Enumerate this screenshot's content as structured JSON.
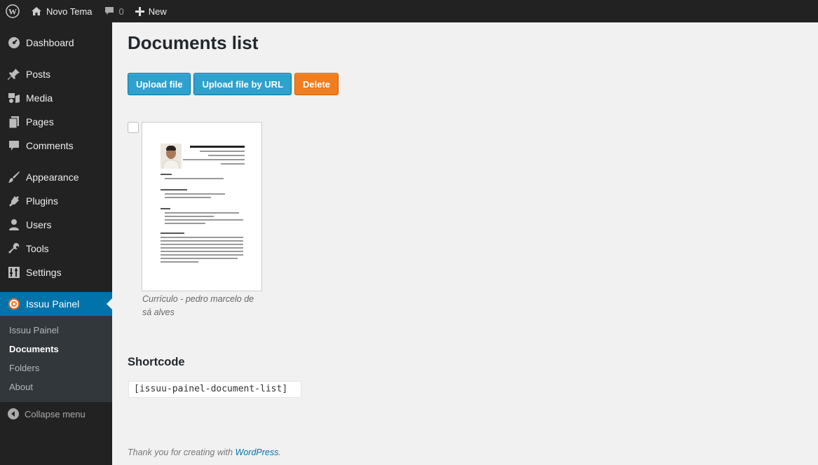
{
  "admin_bar": {
    "site_name": "Novo Tema",
    "comments_count": "0",
    "new_label": "New"
  },
  "sidebar": {
    "items": [
      {
        "label": "Dashboard",
        "icon": "dashboard-icon"
      },
      {
        "label": "Posts",
        "icon": "pin-icon"
      },
      {
        "label": "Media",
        "icon": "media-icon"
      },
      {
        "label": "Pages",
        "icon": "pages-icon"
      },
      {
        "label": "Comments",
        "icon": "comment-icon"
      },
      {
        "label": "Appearance",
        "icon": "brush-icon"
      },
      {
        "label": "Plugins",
        "icon": "plug-icon"
      },
      {
        "label": "Users",
        "icon": "user-icon"
      },
      {
        "label": "Tools",
        "icon": "wrench-icon"
      },
      {
        "label": "Settings",
        "icon": "settings-icon"
      },
      {
        "label": "Issuu Painel",
        "icon": "issuu-icon"
      }
    ],
    "submenu": [
      "Issuu Painel",
      "Documents",
      "Folders",
      "About"
    ],
    "active_submenu": "Documents",
    "collapse_label": "Collapse menu"
  },
  "main": {
    "title": "Documents list",
    "buttons": {
      "upload": "Upload file",
      "upload_url": "Upload file by URL",
      "delete": "Delete"
    },
    "document": {
      "caption": "Currículo - pedro marcelo de sá alves",
      "selected": false
    },
    "shortcode_title": "Shortcode",
    "shortcode_value": "[issuu-painel-document-list]"
  },
  "footer": {
    "text": "Thank you for creating with ",
    "link": "WordPress",
    "suffix": "."
  },
  "colors": {
    "admin_dark": "#222222",
    "active_blue": "#0073aa",
    "button_blue": "#2ea2cc",
    "delete_orange": "#f07d1f"
  }
}
